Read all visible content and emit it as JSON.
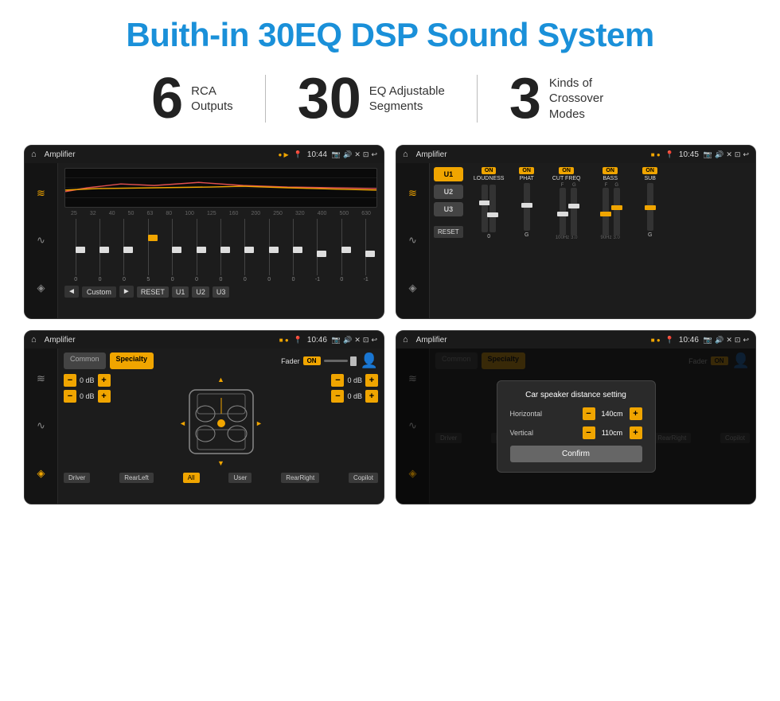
{
  "title": "Buith-in 30EQ DSP Sound System",
  "stats": [
    {
      "number": "6",
      "label": "RCA\nOutputs"
    },
    {
      "number": "30",
      "label": "EQ Adjustable\nSegments"
    },
    {
      "number": "3",
      "label": "Kinds of\nCrossover Modes"
    }
  ],
  "screens": {
    "eq": {
      "status": {
        "app": "Amplifier",
        "time": "10:44"
      },
      "freq_labels": [
        "25",
        "32",
        "40",
        "50",
        "63",
        "80",
        "100",
        "125",
        "160",
        "200",
        "250",
        "320",
        "400",
        "500",
        "630"
      ],
      "slider_values": [
        "0",
        "0",
        "0",
        "5",
        "0",
        "0",
        "0",
        "0",
        "0",
        "0",
        "-1",
        "0",
        "-1"
      ],
      "bottom_buttons": [
        "◄",
        "Custom",
        "►",
        "RESET",
        "U1",
        "U2",
        "U3"
      ]
    },
    "crossover": {
      "status": {
        "app": "Amplifier",
        "time": "10:45"
      },
      "u_buttons": [
        "U1",
        "U2",
        "U3"
      ],
      "controls": [
        {
          "on": true,
          "label": "LOUDNESS"
        },
        {
          "on": true,
          "label": "PHAT"
        },
        {
          "on": true,
          "label": "CUT FREQ"
        },
        {
          "on": true,
          "label": "BASS"
        },
        {
          "on": true,
          "label": "SUB"
        }
      ],
      "reset_btn": "RESET"
    },
    "speaker": {
      "status": {
        "app": "Amplifier",
        "time": "10:46"
      },
      "presets": [
        "Common",
        "Specialty"
      ],
      "active_preset": "Specialty",
      "fader_label": "Fader",
      "fader_on": "ON",
      "controls": [
        {
          "value": "0 dB"
        },
        {
          "value": "0 dB"
        },
        {
          "value": "0 dB"
        },
        {
          "value": "0 dB"
        }
      ],
      "zones": [
        "Driver",
        "RearLeft",
        "All",
        "User",
        "RearRight",
        "Copilot"
      ]
    },
    "dialog": {
      "status": {
        "app": "Amplifier",
        "time": "10:46"
      },
      "presets": [
        "Common",
        "Specialty"
      ],
      "active_preset": "Specialty",
      "dialog": {
        "title": "Car speaker distance setting",
        "fields": [
          {
            "label": "Horizontal",
            "value": "140cm"
          },
          {
            "label": "Vertical",
            "value": "110cm"
          }
        ],
        "confirm_btn": "Confirm"
      },
      "zones_right": [
        "Copilot",
        "RearRight"
      ],
      "zones_left": [
        "Driver",
        "RearLeft"
      ]
    }
  }
}
